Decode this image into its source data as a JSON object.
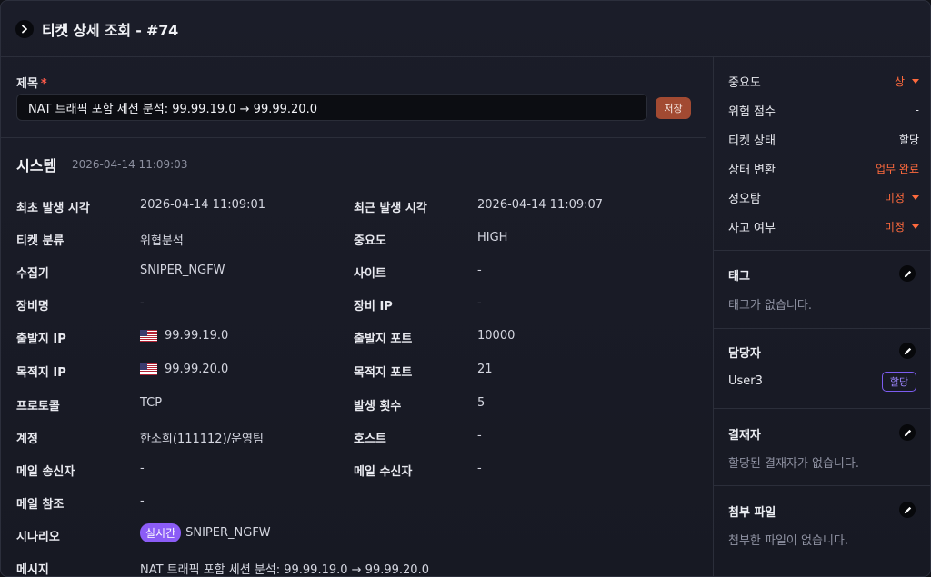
{
  "header": {
    "title": "티켓 상세 조회 - #74"
  },
  "subject": {
    "label": "제목",
    "required_mark": "*",
    "value": "NAT 트래픽 포함 세션 분석: 99.99.19.0 → 99.99.20.0",
    "save_label": "저장"
  },
  "system": {
    "title": "시스템",
    "timestamp": "2026-04-14 11:09:03",
    "rows": [
      {
        "l1": "최초 발생 시각",
        "v1": "2026-04-14 11:09:01",
        "l2": "최근 발생 시각",
        "v2": "2026-04-14 11:09:07"
      },
      {
        "l1": "티켓 분류",
        "v1": "위협분석",
        "l2": "중요도",
        "v2": "HIGH"
      },
      {
        "l1": "수집기",
        "v1": "SNIPER_NGFW",
        "l2": "사이트",
        "v2": "-"
      },
      {
        "l1": "장비명",
        "v1": "-",
        "l2": "장비 IP",
        "v2": "-"
      },
      {
        "l1": "출발지 IP",
        "v1": "99.99.19.0",
        "l2": "출발지 포트",
        "v2": "10000"
      },
      {
        "l1": "목적지 IP",
        "v1": "99.99.20.0",
        "l2": "목적지 포트",
        "v2": "21"
      },
      {
        "l1": "프로토콜",
        "v1": "TCP",
        "l2": "발생 횟수",
        "v2": "5"
      },
      {
        "l1": "계정",
        "v1": "한소희(111112)/운영팀",
        "l2": "호스트",
        "v2": "-"
      },
      {
        "l1": "메일 송신자",
        "v1": "-",
        "l2": "메일 수신자",
        "v2": "-"
      },
      {
        "l1": "메일 참조",
        "v1": "-"
      }
    ],
    "scenario": {
      "label": "시나리오",
      "badge": "실시간",
      "value": "SNIPER_NGFW"
    },
    "message": {
      "label": "메시지",
      "value": "NAT 트래픽 포함 세션 분석: 99.99.19.0 → 99.99.20.0"
    }
  },
  "side": {
    "props": [
      {
        "label": "중요도",
        "value": "상"
      },
      {
        "label": "위험 점수",
        "value": "-"
      },
      {
        "label": "티켓 상태",
        "value": "할당"
      },
      {
        "label": "상태 변환",
        "value": "업무 완료"
      },
      {
        "label": "정오탐",
        "value": "미정"
      },
      {
        "label": "사고 여부",
        "value": "미정"
      }
    ],
    "tags": {
      "title": "태그",
      "empty": "태그가 없습니다."
    },
    "assignee": {
      "title": "담당자",
      "name": "User3",
      "assign_label": "할당"
    },
    "approver": {
      "title": "결재자",
      "empty": "할당된 결재자가 없습니다."
    },
    "attachments": {
      "title": "첨부 파일",
      "empty": "첨부한 파일이 없습니다."
    }
  },
  "colors": {
    "accent": "#ff6a3d",
    "save": "#a24a32",
    "purple": "#8b5cf6"
  },
  "icons": [
    "chevron-right-icon",
    "us-flag-icon",
    "pencil-icon",
    "caret-down-icon"
  ]
}
